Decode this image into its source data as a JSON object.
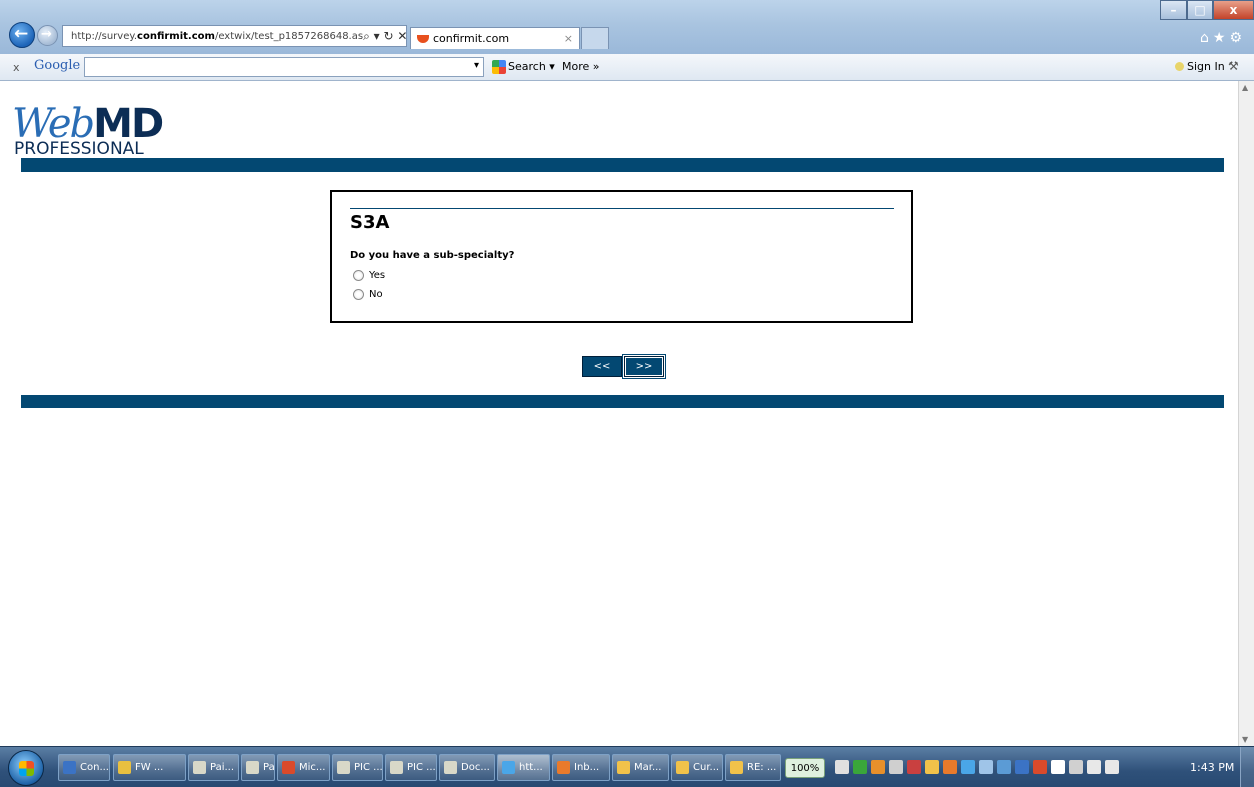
{
  "browser": {
    "url_prefix": "http://survey.",
    "url_domain": "confirmit.com",
    "url_suffix": "/extwix/test_p1857268648.as",
    "address_icons": "⌕ ▾ ↻ ✕",
    "tab_title": "confirmit.com",
    "tab_close": "×",
    "window_minimize": "–",
    "window_maximize": "□",
    "window_close": "x",
    "toolbar_icons": "⌂★⚙"
  },
  "google_toolbar": {
    "close": "x",
    "logo": "Google",
    "dropdown_arrow": "▾",
    "search_label": "Search ▾",
    "more_label": "More »",
    "sign_in_label": "Sign In",
    "wrench": "⚒"
  },
  "logo": {
    "web": "Web",
    "md": "MD",
    "professional": "PROFESSIONAL"
  },
  "survey": {
    "question_id": "S3A",
    "question_text": "Do you have a sub-specialty?",
    "options": [
      {
        "label": "Yes"
      },
      {
        "label": "No"
      }
    ],
    "prev_label": "<<",
    "next_label": ">>"
  },
  "taskbar": {
    "items": [
      {
        "label": "Con..."
      },
      {
        "label": "FW ..."
      },
      {
        "label": "Pai..."
      },
      {
        "label": "Pay..."
      },
      {
        "label": "Mic..."
      },
      {
        "label": "PIC ..."
      },
      {
        "label": "PIC ..."
      },
      {
        "label": "Doc..."
      },
      {
        "label": "htt..."
      },
      {
        "label": "Inb..."
      },
      {
        "label": "Mar..."
      },
      {
        "label": "Cur..."
      },
      {
        "label": "RE: ..."
      }
    ],
    "zoom": "100%",
    "clock": "1:43 PM"
  },
  "colors": {
    "brand_navy": "#034872",
    "logo_blue": "#2a6db5"
  }
}
